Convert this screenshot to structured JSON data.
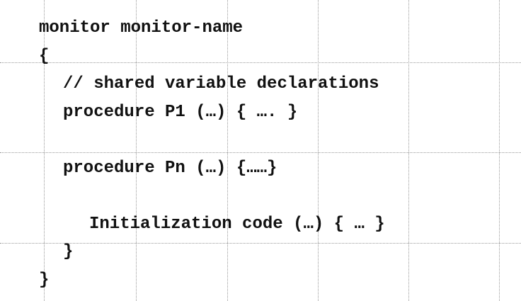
{
  "code": {
    "lines": [
      "monitor monitor-name",
      "{",
      "// shared variable declarations",
      "procedure P1 (…) { …. }",
      "procedure Pn (…) {……}",
      "Initialization code (…) { … }",
      "}",
      "}"
    ]
  },
  "colors": {
    "text": "#111111",
    "background": "#ffffff",
    "guide": "#9a9a9a"
  }
}
